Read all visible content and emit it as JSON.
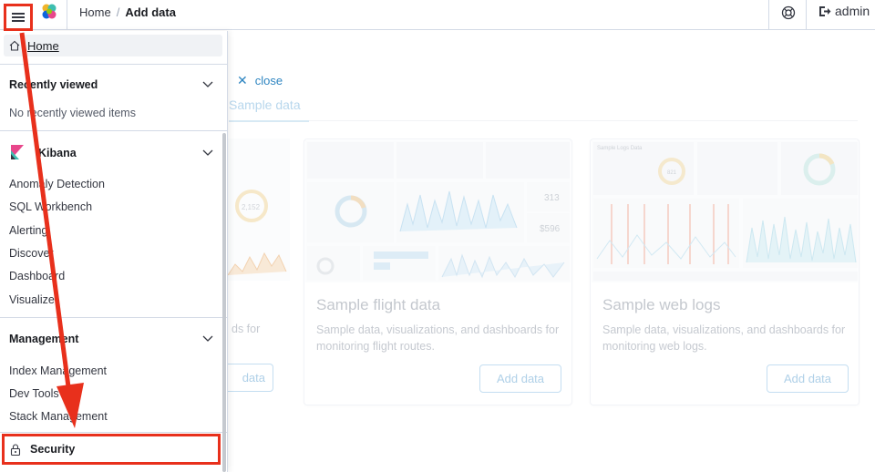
{
  "header": {
    "breadcrumb_home": "Home",
    "breadcrumb_separator": "/",
    "breadcrumb_current": "Add data",
    "user_label": "admin",
    "menu_icon": "hamburger-menu-icon",
    "logo_icon": "elastic-logo-icon",
    "help_icon": "help-lifebuoy-icon",
    "logout_icon": "logout-icon"
  },
  "background": {
    "close_label": "close",
    "tab_label": "Sample data",
    "cards": [
      {
        "title": "Sample flight data",
        "description": "Sample data, visualizations, and dashboards for monitoring flight routes.",
        "button": "Add data",
        "stats": [
          "313",
          "$596"
        ]
      },
      {
        "title": "Sample web logs",
        "description": "Sample data, visualizations, and dashboards for monitoring web logs.",
        "button": "Add data",
        "stats": [
          "Sample Logs Data",
          "821"
        ]
      }
    ],
    "partial_card": {
      "desc_fragment": "ds for",
      "button_fragment": "data",
      "stat": "2,152"
    }
  },
  "sidenav": {
    "home_label": "Home",
    "recently_viewed": {
      "title": "Recently viewed",
      "empty_text": "No recently viewed items"
    },
    "kibana": {
      "title": "Kibana",
      "items": [
        "Anomaly Detection",
        "SQL Workbench",
        "Alerting",
        "Discover",
        "Dashboard",
        "Visualize"
      ]
    },
    "management": {
      "title": "Management",
      "items": [
        "Index Management",
        "Dev Tools",
        "Stack Management"
      ]
    },
    "security_label": "Security"
  },
  "colors": {
    "annotation_red": "#e8301c",
    "link_blue": "#006bb4",
    "text_dark": "#1a1c21",
    "border": "#d3dae6"
  }
}
